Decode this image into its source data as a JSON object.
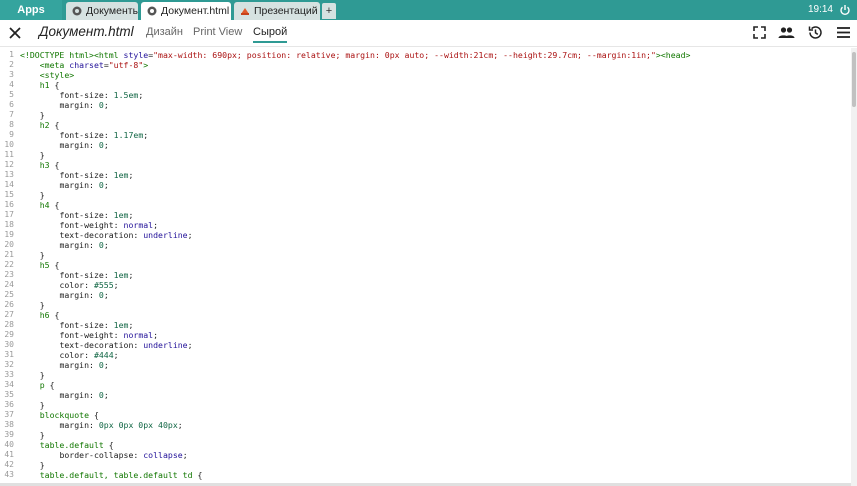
{
  "shelf": {
    "apps_label": "Apps",
    "tabs": [
      {
        "label": "Документы",
        "icon": "docs-app-icon"
      },
      {
        "label": "Документ.html",
        "icon": "document-app-icon"
      },
      {
        "label": "Презентаций",
        "icon": "presentation-app-icon"
      }
    ],
    "new_tab_label": "+",
    "clock": "19:14"
  },
  "toolbar": {
    "doc_title": "Документ.html",
    "view_tabs": [
      "Дизайн",
      "Print View",
      "Сырой"
    ],
    "active_view": "Сырой",
    "icons": [
      "fullscreen-icon",
      "people-icon",
      "history-icon",
      "menu-icon"
    ]
  },
  "colors": {
    "shelf": "#2f9a94",
    "accent": "#2f9a94",
    "tag": "#117700",
    "string": "#aa1111",
    "keyword": "#221199",
    "number": "#116644"
  },
  "code_lines": [
    [
      [
        "tok-tag",
        "<!DOCTYPE html>"
      ],
      [
        "tok-tag",
        "<html "
      ],
      [
        "tok-kw",
        "style"
      ],
      [
        "tok-punct",
        "="
      ],
      [
        "tok-str",
        "\"max-width: 690px; position: relative; margin: 0px auto; --width:21cm; --height:29.7cm; --margin:1in;\""
      ],
      [
        "tok-tag",
        ">"
      ],
      [
        "tok-tag",
        "<head>"
      ]
    ],
    [
      [
        "tok-plain",
        "    "
      ],
      [
        "tok-tag",
        "<meta "
      ],
      [
        "tok-kw",
        "charset"
      ],
      [
        "tok-punct",
        "="
      ],
      [
        "tok-str",
        "\"utf-8\""
      ],
      [
        "tok-tag",
        ">"
      ]
    ],
    [
      [
        "tok-plain",
        "    "
      ],
      [
        "tok-tag",
        "<style>"
      ]
    ],
    [
      [
        "tok-plain",
        "    "
      ],
      [
        "tok-sel",
        "h1 "
      ],
      [
        "tok-punct",
        "{"
      ]
    ],
    [
      [
        "tok-plain",
        "        "
      ],
      [
        "tok-prop",
        "font-size"
      ],
      [
        "tok-punct",
        ": "
      ],
      [
        "tok-num",
        "1.5em"
      ],
      [
        "tok-punct",
        ";"
      ]
    ],
    [
      [
        "tok-plain",
        "        "
      ],
      [
        "tok-prop",
        "margin"
      ],
      [
        "tok-punct",
        ": "
      ],
      [
        "tok-num",
        "0"
      ],
      [
        "tok-punct",
        ";"
      ]
    ],
    [
      [
        "tok-plain",
        "    "
      ],
      [
        "tok-punct",
        "}"
      ]
    ],
    [
      [
        "tok-plain",
        "    "
      ],
      [
        "tok-sel",
        "h2 "
      ],
      [
        "tok-punct",
        "{"
      ]
    ],
    [
      [
        "tok-plain",
        "        "
      ],
      [
        "tok-prop",
        "font-size"
      ],
      [
        "tok-punct",
        ": "
      ],
      [
        "tok-num",
        "1.17em"
      ],
      [
        "tok-punct",
        ";"
      ]
    ],
    [
      [
        "tok-plain",
        "        "
      ],
      [
        "tok-prop",
        "margin"
      ],
      [
        "tok-punct",
        ": "
      ],
      [
        "tok-num",
        "0"
      ],
      [
        "tok-punct",
        ";"
      ]
    ],
    [
      [
        "tok-plain",
        "    "
      ],
      [
        "tok-punct",
        "}"
      ]
    ],
    [
      [
        "tok-plain",
        "    "
      ],
      [
        "tok-sel",
        "h3 "
      ],
      [
        "tok-punct",
        "{"
      ]
    ],
    [
      [
        "tok-plain",
        "        "
      ],
      [
        "tok-prop",
        "font-size"
      ],
      [
        "tok-punct",
        ": "
      ],
      [
        "tok-num",
        "1em"
      ],
      [
        "tok-punct",
        ";"
      ]
    ],
    [
      [
        "tok-plain",
        "        "
      ],
      [
        "tok-prop",
        "margin"
      ],
      [
        "tok-punct",
        ": "
      ],
      [
        "tok-num",
        "0"
      ],
      [
        "tok-punct",
        ";"
      ]
    ],
    [
      [
        "tok-plain",
        "    "
      ],
      [
        "tok-punct",
        "}"
      ]
    ],
    [
      [
        "tok-plain",
        "    "
      ],
      [
        "tok-sel",
        "h4 "
      ],
      [
        "tok-punct",
        "{"
      ]
    ],
    [
      [
        "tok-plain",
        "        "
      ],
      [
        "tok-prop",
        "font-size"
      ],
      [
        "tok-punct",
        ": "
      ],
      [
        "tok-num",
        "1em"
      ],
      [
        "tok-punct",
        ";"
      ]
    ],
    [
      [
        "tok-plain",
        "        "
      ],
      [
        "tok-prop",
        "font-weight"
      ],
      [
        "tok-punct",
        ": "
      ],
      [
        "tok-kw",
        "normal"
      ],
      [
        "tok-punct",
        ";"
      ]
    ],
    [
      [
        "tok-plain",
        "        "
      ],
      [
        "tok-prop",
        "text-decoration"
      ],
      [
        "tok-punct",
        ": "
      ],
      [
        "tok-kw",
        "underline"
      ],
      [
        "tok-punct",
        ";"
      ]
    ],
    [
      [
        "tok-plain",
        "        "
      ],
      [
        "tok-prop",
        "margin"
      ],
      [
        "tok-punct",
        ": "
      ],
      [
        "tok-num",
        "0"
      ],
      [
        "tok-punct",
        ";"
      ]
    ],
    [
      [
        "tok-plain",
        "    "
      ],
      [
        "tok-punct",
        "}"
      ]
    ],
    [
      [
        "tok-plain",
        "    "
      ],
      [
        "tok-sel",
        "h5 "
      ],
      [
        "tok-punct",
        "{"
      ]
    ],
    [
      [
        "tok-plain",
        "        "
      ],
      [
        "tok-prop",
        "font-size"
      ],
      [
        "tok-punct",
        ": "
      ],
      [
        "tok-num",
        "1em"
      ],
      [
        "tok-punct",
        ";"
      ]
    ],
    [
      [
        "tok-plain",
        "        "
      ],
      [
        "tok-prop",
        "color"
      ],
      [
        "tok-punct",
        ": "
      ],
      [
        "tok-num",
        "#555"
      ],
      [
        "tok-punct",
        ";"
      ]
    ],
    [
      [
        "tok-plain",
        "        "
      ],
      [
        "tok-prop",
        "margin"
      ],
      [
        "tok-punct",
        ": "
      ],
      [
        "tok-num",
        "0"
      ],
      [
        "tok-punct",
        ";"
      ]
    ],
    [
      [
        "tok-plain",
        "    "
      ],
      [
        "tok-punct",
        "}"
      ]
    ],
    [
      [
        "tok-plain",
        "    "
      ],
      [
        "tok-sel",
        "h6 "
      ],
      [
        "tok-punct",
        "{"
      ]
    ],
    [
      [
        "tok-plain",
        "        "
      ],
      [
        "tok-prop",
        "font-size"
      ],
      [
        "tok-punct",
        ": "
      ],
      [
        "tok-num",
        "1em"
      ],
      [
        "tok-punct",
        ";"
      ]
    ],
    [
      [
        "tok-plain",
        "        "
      ],
      [
        "tok-prop",
        "font-weight"
      ],
      [
        "tok-punct",
        ": "
      ],
      [
        "tok-kw",
        "normal"
      ],
      [
        "tok-punct",
        ";"
      ]
    ],
    [
      [
        "tok-plain",
        "        "
      ],
      [
        "tok-prop",
        "text-decoration"
      ],
      [
        "tok-punct",
        ": "
      ],
      [
        "tok-kw",
        "underline"
      ],
      [
        "tok-punct",
        ";"
      ]
    ],
    [
      [
        "tok-plain",
        "        "
      ],
      [
        "tok-prop",
        "color"
      ],
      [
        "tok-punct",
        ": "
      ],
      [
        "tok-num",
        "#444"
      ],
      [
        "tok-punct",
        ";"
      ]
    ],
    [
      [
        "tok-plain",
        "        "
      ],
      [
        "tok-prop",
        "margin"
      ],
      [
        "tok-punct",
        ": "
      ],
      [
        "tok-num",
        "0"
      ],
      [
        "tok-punct",
        ";"
      ]
    ],
    [
      [
        "tok-plain",
        "    "
      ],
      [
        "tok-punct",
        "}"
      ]
    ],
    [
      [
        "tok-plain",
        "    "
      ],
      [
        "tok-sel",
        "p "
      ],
      [
        "tok-punct",
        "{"
      ]
    ],
    [
      [
        "tok-plain",
        "        "
      ],
      [
        "tok-prop",
        "margin"
      ],
      [
        "tok-punct",
        ": "
      ],
      [
        "tok-num",
        "0"
      ],
      [
        "tok-punct",
        ";"
      ]
    ],
    [
      [
        "tok-plain",
        "    "
      ],
      [
        "tok-punct",
        "}"
      ]
    ],
    [
      [
        "tok-plain",
        "    "
      ],
      [
        "tok-sel",
        "blockquote "
      ],
      [
        "tok-punct",
        "{"
      ]
    ],
    [
      [
        "tok-plain",
        "        "
      ],
      [
        "tok-prop",
        "margin"
      ],
      [
        "tok-punct",
        ": "
      ],
      [
        "tok-num",
        "0px 0px 0px 40px"
      ],
      [
        "tok-punct",
        ";"
      ]
    ],
    [
      [
        "tok-plain",
        "    "
      ],
      [
        "tok-punct",
        "}"
      ]
    ],
    [
      [
        "tok-plain",
        "    "
      ],
      [
        "tok-sel",
        "table.default "
      ],
      [
        "tok-punct",
        "{"
      ]
    ],
    [
      [
        "tok-plain",
        "        "
      ],
      [
        "tok-prop",
        "border-collapse"
      ],
      [
        "tok-punct",
        ": "
      ],
      [
        "tok-kw",
        "collapse"
      ],
      [
        "tok-punct",
        ";"
      ]
    ],
    [
      [
        "tok-plain",
        "    "
      ],
      [
        "tok-punct",
        "}"
      ]
    ],
    [
      [
        "tok-plain",
        "    "
      ],
      [
        "tok-sel",
        "table.default, table.default td "
      ],
      [
        "tok-punct",
        "{"
      ]
    ]
  ]
}
